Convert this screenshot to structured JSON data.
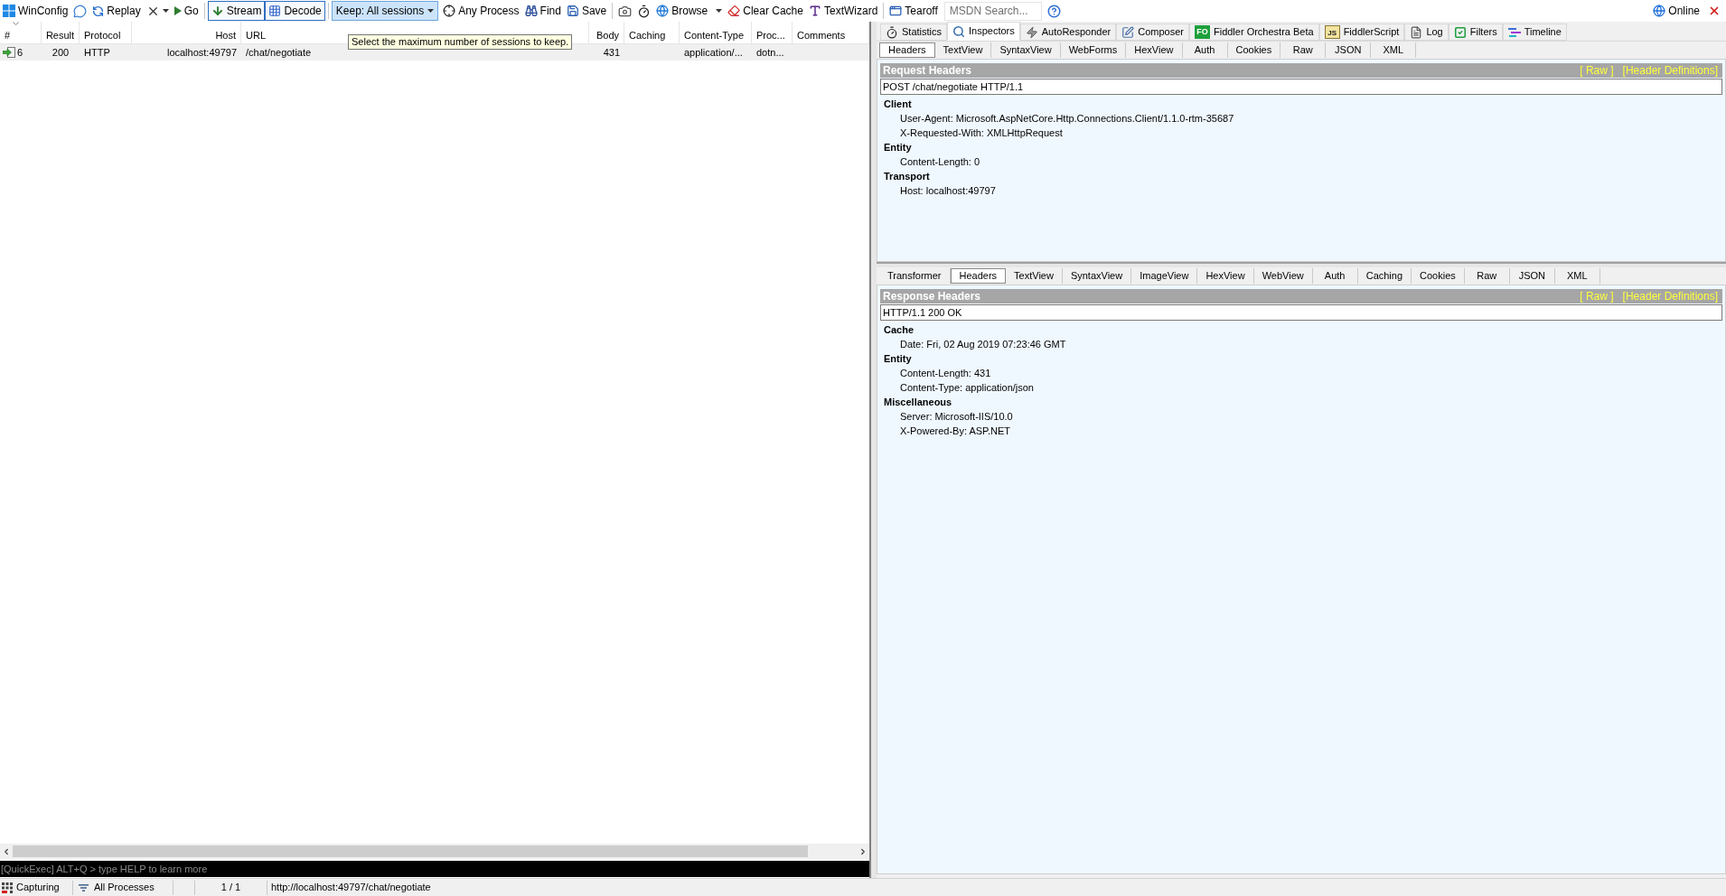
{
  "toolbar": {
    "commands": [
      {
        "kind": "labeled",
        "label": "WinConfig"
      },
      {
        "kind": "icon"
      },
      {
        "kind": "labeled",
        "label": "Replay"
      },
      {
        "kind": "icon_menu"
      },
      {
        "kind": "labeled",
        "label": "Go"
      }
    ],
    "toggles": [
      {
        "label": "Stream",
        "on": true
      },
      {
        "label": "Decode",
        "on": true
      }
    ],
    "keep_sessions": {
      "label": "Keep: All sessions",
      "hovered": true,
      "tooltip": "Select the maximum number of sessions to keep."
    },
    "tools": [
      [
        {
          "kind": "labeled",
          "label": "Any Process"
        },
        {
          "kind": "labeled",
          "label": "Find"
        },
        {
          "kind": "labeled",
          "label": "Save"
        }
      ],
      [
        {
          "kind": "icon"
        },
        {
          "kind": "icon"
        },
        {
          "kind": "menu",
          "label": "Browse"
        },
        {
          "kind": "labeled",
          "label": "Clear Cache"
        },
        {
          "kind": "labeled",
          "label": "TextWizard"
        }
      ],
      [
        {
          "kind": "labeled",
          "label": "Tearoff"
        }
      ]
    ],
    "search": {
      "placeholder": "MSDN Search..."
    },
    "connection": {
      "label": "Online"
    }
  },
  "sessions": {
    "columns": [
      {
        "label": "#",
        "sorted": true
      },
      {
        "label": "Result",
        "sorted": false
      },
      {
        "label": "Protocol",
        "sorted": false
      },
      {
        "label": "Host",
        "sorted": false
      },
      {
        "label": "URL",
        "sorted": false
      },
      {
        "label": "Body",
        "sorted": false
      },
      {
        "label": "Caching",
        "sorted": false
      },
      {
        "label": "Content-Type",
        "sorted": false
      },
      {
        "label": "Proc...",
        "sorted": false
      },
      {
        "label": "Comments",
        "sorted": false
      }
    ],
    "rows": [
      {
        "selected": true,
        "number": "6",
        "result": "200",
        "protocol": "HTTP",
        "host": "localhost:49797",
        "url": "/chat/negotiate",
        "body": "431",
        "content_type": "application/...",
        "column_9": "dotn..."
      }
    ]
  },
  "quickexec": {
    "placeholder": "[QuickExec] ALT+Q > type HELP to learn more"
  },
  "inspector_tabs": [
    {
      "label": "Statistics",
      "selected": false
    },
    {
      "label": "Inspectors",
      "selected": true
    },
    {
      "label": "AutoResponder",
      "selected": false
    },
    {
      "label": "Composer",
      "selected": false
    },
    {
      "label": "Fiddler Orchestra Beta",
      "selected": false,
      "badge": "FO"
    },
    {
      "label": "FiddlerScript",
      "selected": false,
      "badge": "JS"
    },
    {
      "label": "Log",
      "selected": false
    },
    {
      "label": "Filters",
      "selected": false
    },
    {
      "label": "Timeline",
      "selected": false
    }
  ],
  "request": {
    "tabs": [
      {
        "label": "Headers",
        "selected": true
      },
      {
        "label": "TextView",
        "selected": false
      },
      {
        "label": "SyntaxView",
        "selected": false
      },
      {
        "label": "WebForms",
        "selected": false
      },
      {
        "label": "HexView",
        "selected": false
      },
      {
        "label": "Auth",
        "selected": false
      },
      {
        "label": "Cookies",
        "selected": false
      },
      {
        "label": "Raw",
        "selected": false
      },
      {
        "label": "JSON",
        "selected": false
      },
      {
        "label": "XML",
        "selected": false
      }
    ],
    "title": "Request Headers",
    "links": [
      "[ Raw ]",
      "[Header Definitions]"
    ],
    "start_line": "POST /chat/negotiate HTTP/1.1",
    "groups": [
      {
        "label": "Client",
        "children": [
          {
            "label": "User-Agent: Microsoft.AspNetCore.Http.Connections.Client/1.1.0-rtm-35687"
          },
          {
            "label": "X-Requested-With: XMLHttpRequest"
          }
        ]
      },
      {
        "label": "Entity",
        "children": [
          {
            "label": "Content-Length: 0"
          }
        ]
      },
      {
        "label": "Transport",
        "children": [
          {
            "label": "Host: localhost:49797"
          }
        ]
      }
    ]
  },
  "response": {
    "tabs": [
      {
        "label": "Transformer",
        "selected": false
      },
      {
        "label": "Headers",
        "selected": true
      },
      {
        "label": "TextView",
        "selected": false
      },
      {
        "label": "SyntaxView",
        "selected": false
      },
      {
        "label": "ImageView",
        "selected": false
      },
      {
        "label": "HexView",
        "selected": false
      },
      {
        "label": "WebView",
        "selected": false
      },
      {
        "label": "Auth",
        "selected": false
      },
      {
        "label": "Caching",
        "selected": false
      },
      {
        "label": "Cookies",
        "selected": false
      },
      {
        "label": "Raw",
        "selected": false
      },
      {
        "label": "JSON",
        "selected": false
      },
      {
        "label": "XML",
        "selected": false
      }
    ],
    "title": "Response Headers",
    "links": [
      "[ Raw ]",
      "[Header Definitions]"
    ],
    "start_line": "HTTP/1.1 200 OK",
    "groups": [
      {
        "label": "Cache",
        "children": [
          {
            "label": "Date: Fri, 02 Aug 2019 07:23:46 GMT"
          }
        ]
      },
      {
        "label": "Entity",
        "children": [
          {
            "label": "Content-Length: 431"
          },
          {
            "label": "Content-Type: application/json"
          }
        ]
      },
      {
        "label": "Miscellaneous",
        "children": [
          {
            "label": "Server: Microsoft-IIS/10.0"
          },
          {
            "label": "X-Powered-By: ASP.NET"
          }
        ]
      }
    ]
  },
  "status_bar": {
    "capture": "Capturing",
    "process_filter": "All Processes",
    "session_count": "1 / 1",
    "url": "http://localhost:49797/chat/negotiate"
  }
}
